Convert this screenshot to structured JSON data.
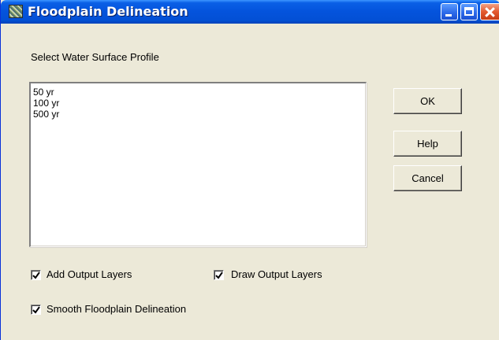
{
  "window": {
    "title": "Floodplain Delineation",
    "icon": "app-icon",
    "controls": [
      "minimize-icon",
      "maximize-icon",
      "close-icon"
    ]
  },
  "prompt": "Select Water Surface Profile",
  "profiles": [
    "50 yr",
    "100 yr",
    "500 yr"
  ],
  "buttons": {
    "ok": "OK",
    "help": "Help",
    "cancel": "Cancel"
  },
  "options": {
    "add_output_layers": {
      "label": "Add Output Layers",
      "checked": true
    },
    "draw_output_layers": {
      "label": "Draw Output Layers",
      "checked": true
    },
    "smooth_floodplain": {
      "label": "Smooth Floodplain Delineation",
      "checked": true
    }
  },
  "colors": {
    "titlebar": "#0453dc",
    "dialog_face": "#ece9d8",
    "close_button": "#e3592f"
  }
}
